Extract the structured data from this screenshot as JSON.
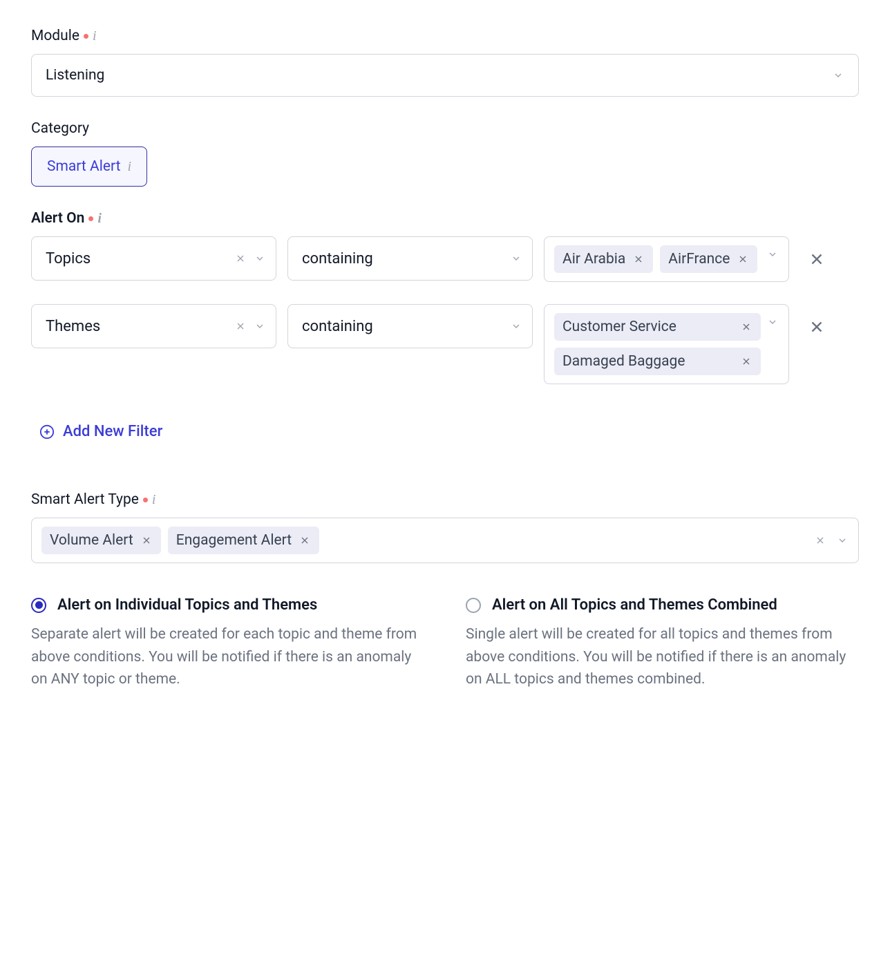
{
  "module": {
    "label": "Module",
    "value": "Listening"
  },
  "category": {
    "label": "Category",
    "option": "Smart Alert"
  },
  "alert_on": {
    "label": "Alert On",
    "rows": [
      {
        "field": "Topics",
        "op": "containing",
        "tags": [
          "Air Arabia",
          "AirFrance"
        ]
      },
      {
        "field": "Themes",
        "op": "containing",
        "tags": [
          "Customer Service",
          "Damaged Baggage"
        ]
      }
    ]
  },
  "add_filter_label": "Add New Filter",
  "smart_type": {
    "label": "Smart Alert Type",
    "tags": [
      "Volume Alert",
      "Engagement Alert"
    ]
  },
  "options": {
    "individual": {
      "title": "Alert on Individual Topics and Themes",
      "desc": "Separate alert will be created for each topic and theme from above conditions. You will be notified if there is an anomaly on ANY topic or theme.",
      "selected": true
    },
    "combined": {
      "title": "Alert on All Topics and Themes Combined",
      "desc": "Single alert will be created for all topics and themes from above conditions. You will be notified if there is an anomaly on ALL topics and themes combined.",
      "selected": false
    }
  }
}
